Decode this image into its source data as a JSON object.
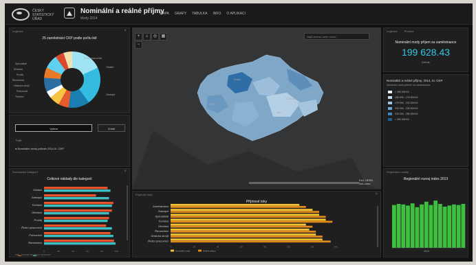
{
  "header": {
    "logo_text": "ČESKÝ STATISTICKÝ ÚŘAD",
    "title": "Nominální a reálné příjmy",
    "subtitle": "Mzdy 2014",
    "nav": [
      "MAPA",
      "GRAFY",
      "TABULKA",
      "INFO",
      "O APLIKACI"
    ]
  },
  "donut_panel": {
    "section_label": "Legenda",
    "heading": "25 zaměstnání CKP podle počtu lidí",
    "labels": [
      "Ostatní",
      "Zástupci",
      "Specialisté",
      "Úředníci",
      "Prodej",
      "Řemeslníci",
      "Obsluha strojů",
      "Pomocníci",
      "Technici",
      "Řídící pracovníci"
    ],
    "sort_label": "Třídit",
    "sort_value": "Nominální mzdy průměr 2014 III. CKP",
    "button_primary": "Vybrat",
    "button_secondary": "Zrušit"
  },
  "map": {
    "search_placeholder": "Najít adresu nebo místo",
    "labels": [
      "Praha",
      "Brno",
      "Ostrava",
      "Plzeň",
      "Olomouc"
    ],
    "attribution": "Esri, HERE, DeLorme"
  },
  "stat_panel": {
    "tabs": [
      "Legenda",
      "Přehled"
    ],
    "heading": "Nominální mzdy příjem za zaměstnance",
    "value": "199 628.43",
    "unit": "Kč/rok",
    "legend_title": "Nominální a reálné příjmy, 2014, III. CKP",
    "legend_subtitle": "Nominální mzdy průměr za zaměstnance",
    "legend_items": [
      {
        "label": "< 150 000 Kč",
        "color": "#e8f2fa"
      },
      {
        "label": "150 000 - 175 000 Kč",
        "color": "#c5dcee"
      },
      {
        "label": "175 000 - 200 000 Kč",
        "color": "#9cc3e2"
      },
      {
        "label": "200 000 - 225 000 Kč",
        "color": "#6ea6d2"
      },
      {
        "label": "225 000 - 250 000 Kč",
        "color": "#3d86be"
      },
      {
        "label": "> 250 000 Kč",
        "color": "#1d5f96"
      }
    ]
  },
  "bar_panel_left": {
    "section_label": "Srovnávání kategorií",
    "heading": "Celkové náklady dle kategorií",
    "categories": [
      "Ostatní",
      "Zástupci",
      "Technici",
      "Úředníci",
      "Prodej",
      "Řídící pracovníci",
      "Pomocníci",
      "Řemeslníci"
    ],
    "series": [
      {
        "name": "CTRL",
        "color": "#e8542e",
        "values": [
          88,
          72,
          96,
          94,
          90,
          86,
          92,
          97
        ]
      },
      {
        "name": "CTRL2",
        "color": "#3cc0c4",
        "values": [
          92,
          90,
          94,
          90,
          88,
          94,
          96,
          99
        ]
      }
    ],
    "ticks": [
      "0",
      "20",
      "40",
      "60",
      "80",
      "100"
    ],
    "footnote": "CKP - Centrální klasifikace zaměstnání"
  },
  "bar_panel_center": {
    "section_label": "Příjmové toky",
    "heading": "Příjmové toky",
    "categories": [
      "Zaměstnanci",
      "Zástupci",
      "Specialisté",
      "Technici",
      "Úředníci",
      "Řemeslníci",
      "Obsluha strojů",
      "Řídící pracovníci"
    ],
    "series": [
      {
        "name": "Nominální mzdy",
        "color": "#f2c230",
        "values": [
          78,
          86,
          90,
          94,
          82,
          84,
          88,
          92
        ]
      },
      {
        "name": "Reálné příjmy",
        "color": "#e08a1e",
        "values": [
          82,
          90,
          94,
          98,
          86,
          88,
          92,
          97
        ]
      }
    ],
    "ticks": [
      "0",
      "20",
      "40",
      "60",
      "80",
      "100",
      "120",
      "140"
    ]
  },
  "bar_panel_right": {
    "section_label": "Regionální rozdíly",
    "heading": "Regionální rozvoj index 2013",
    "color": "#3fbf3f",
    "values": [
      78,
      80,
      79,
      77,
      81,
      74,
      79,
      84,
      78,
      86,
      80,
      75,
      77,
      79,
      78,
      80
    ],
    "xlabel": "2013"
  }
}
